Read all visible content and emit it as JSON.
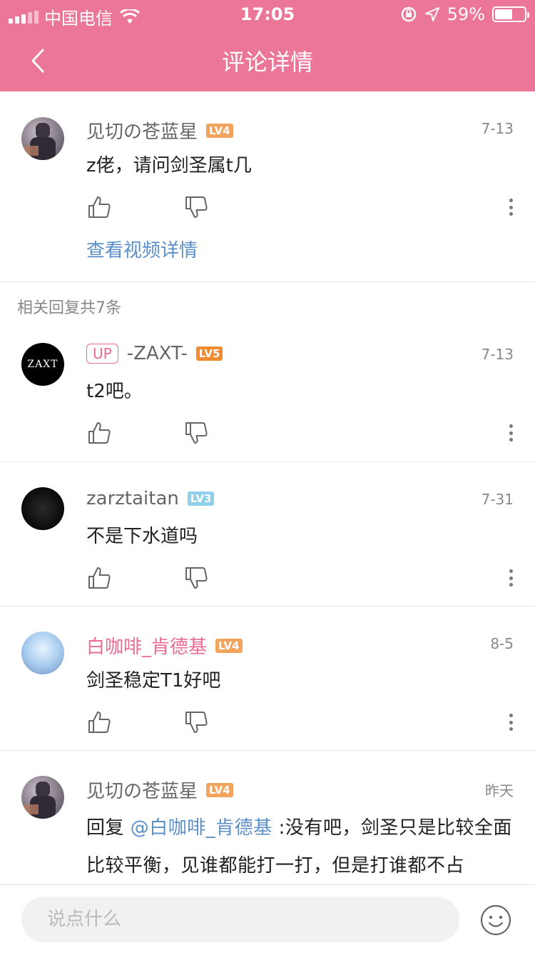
{
  "status": {
    "carrier": "中国电信",
    "time": "17:05",
    "battery": "59%",
    "battery_level": 0.59
  },
  "nav": {
    "title": "评论详情"
  },
  "main_comment": {
    "user": "见切の苍蓝星",
    "level": "LV4",
    "level_color": "#f2a35c",
    "date": "7-13",
    "text": "z佬，请问剑圣属t几",
    "video_link": "查看视频详情"
  },
  "replies_label": "相关回复共7条",
  "replies": [
    {
      "up_tag": "UP",
      "user": "-ZAXT-",
      "level": "LV5",
      "level_color": "#f28a2f",
      "date": "7-13",
      "text": "t2吧。",
      "avatar_text": "ZAXT"
    },
    {
      "user": "zarztaitan",
      "level": "LV3",
      "level_color": "#8fd0ea",
      "date": "7-31",
      "text": "不是下水道吗"
    },
    {
      "user": "白咖啡_肯德基",
      "level": "LV4",
      "level_color": "#f2a35c",
      "date": "8-5",
      "text": "剑圣稳定T1好吧"
    },
    {
      "user": "见切の苍蓝星",
      "level": "LV4",
      "level_color": "#f2a35c",
      "date": "昨天",
      "reply_prefix": "回复",
      "mention": "@白咖啡_肯德基",
      "text": ":没有吧，剑圣只是比较全面比较平衡，见谁都能打一打，但是打谁都不占"
    }
  ],
  "input": {
    "placeholder": "说点什么"
  },
  "colors": {
    "header": "#ec7698",
    "link": "#5b8fc9",
    "pink_name": "#ec6b93"
  }
}
